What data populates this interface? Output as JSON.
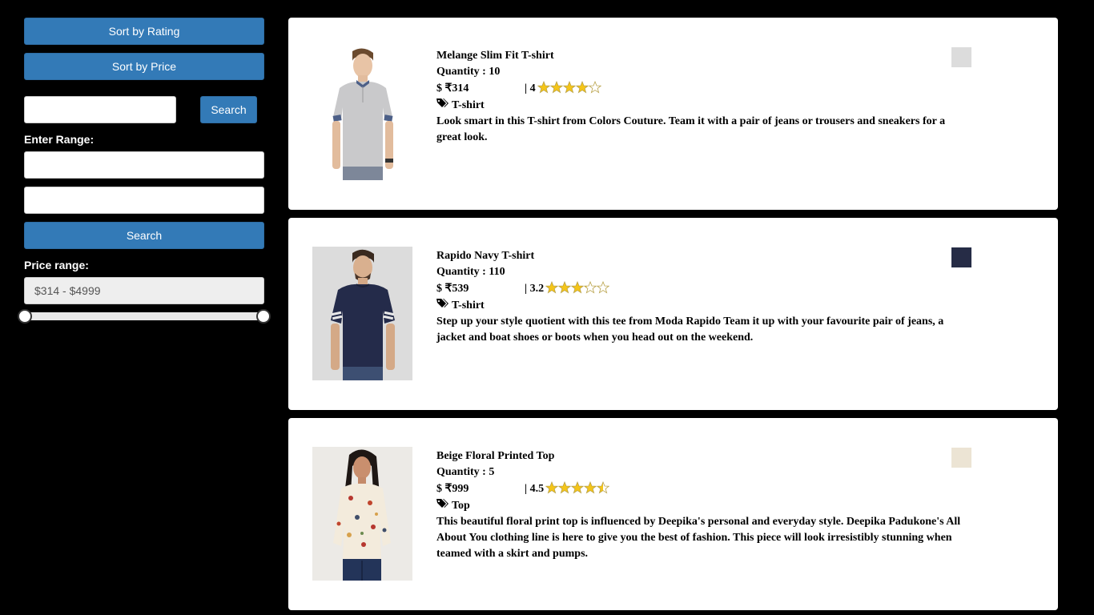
{
  "sidebar": {
    "sort_rating_label": "Sort by Rating",
    "sort_price_label": "Sort by Price",
    "search_button_label": "Search",
    "search_value": "",
    "range_label": "Enter Range:",
    "range_min_value": "",
    "range_max_value": "",
    "range_search_label": "Search",
    "price_range_label": "Price range:",
    "price_range_value": "$314 - $4999",
    "slider": {
      "min": 314,
      "max": 4999,
      "low": 314,
      "high": 4999
    }
  },
  "colors": {
    "button_blue": "#337ab7",
    "star_gold": "#f5c518"
  },
  "products": [
    {
      "name": "Melange Slim Fit T-shirt",
      "quantity": "Quantity : 10",
      "price": "$ ₹314",
      "rating": "| 4",
      "rating_value": 4,
      "category": "T-shirt",
      "description": "Look smart in this T-shirt from Colors Couture. Team it with a pair of jeans or trousers and sneakers for a great look.",
      "swatch_color": "#dcdcdc"
    },
    {
      "name": "Rapido Navy T-shirt",
      "quantity": "Quantity : 110",
      "price": "$ ₹539",
      "rating": "| 3.2",
      "rating_value": 3.2,
      "category": "T-shirt",
      "description": "Step up your style quotient with this tee from Moda Rapido Team it up with your favourite pair of jeans, a jacket and boat shoes or boots when you head out on the weekend.",
      "swatch_color": "#262c46"
    },
    {
      "name": "Beige Floral Printed Top",
      "quantity": "Quantity : 5",
      "price": "$ ₹999",
      "rating": "| 4.5",
      "rating_value": 4.5,
      "category": "Top",
      "description": "This beautiful floral print top is influenced by Deepika's personal and everyday style. Deepika Padukone's All About You clothing line is here to give you the best of fashion. This piece will look irresistibly stunning when teamed with a skirt and pumps.",
      "swatch_color": "#ece4d4"
    }
  ]
}
